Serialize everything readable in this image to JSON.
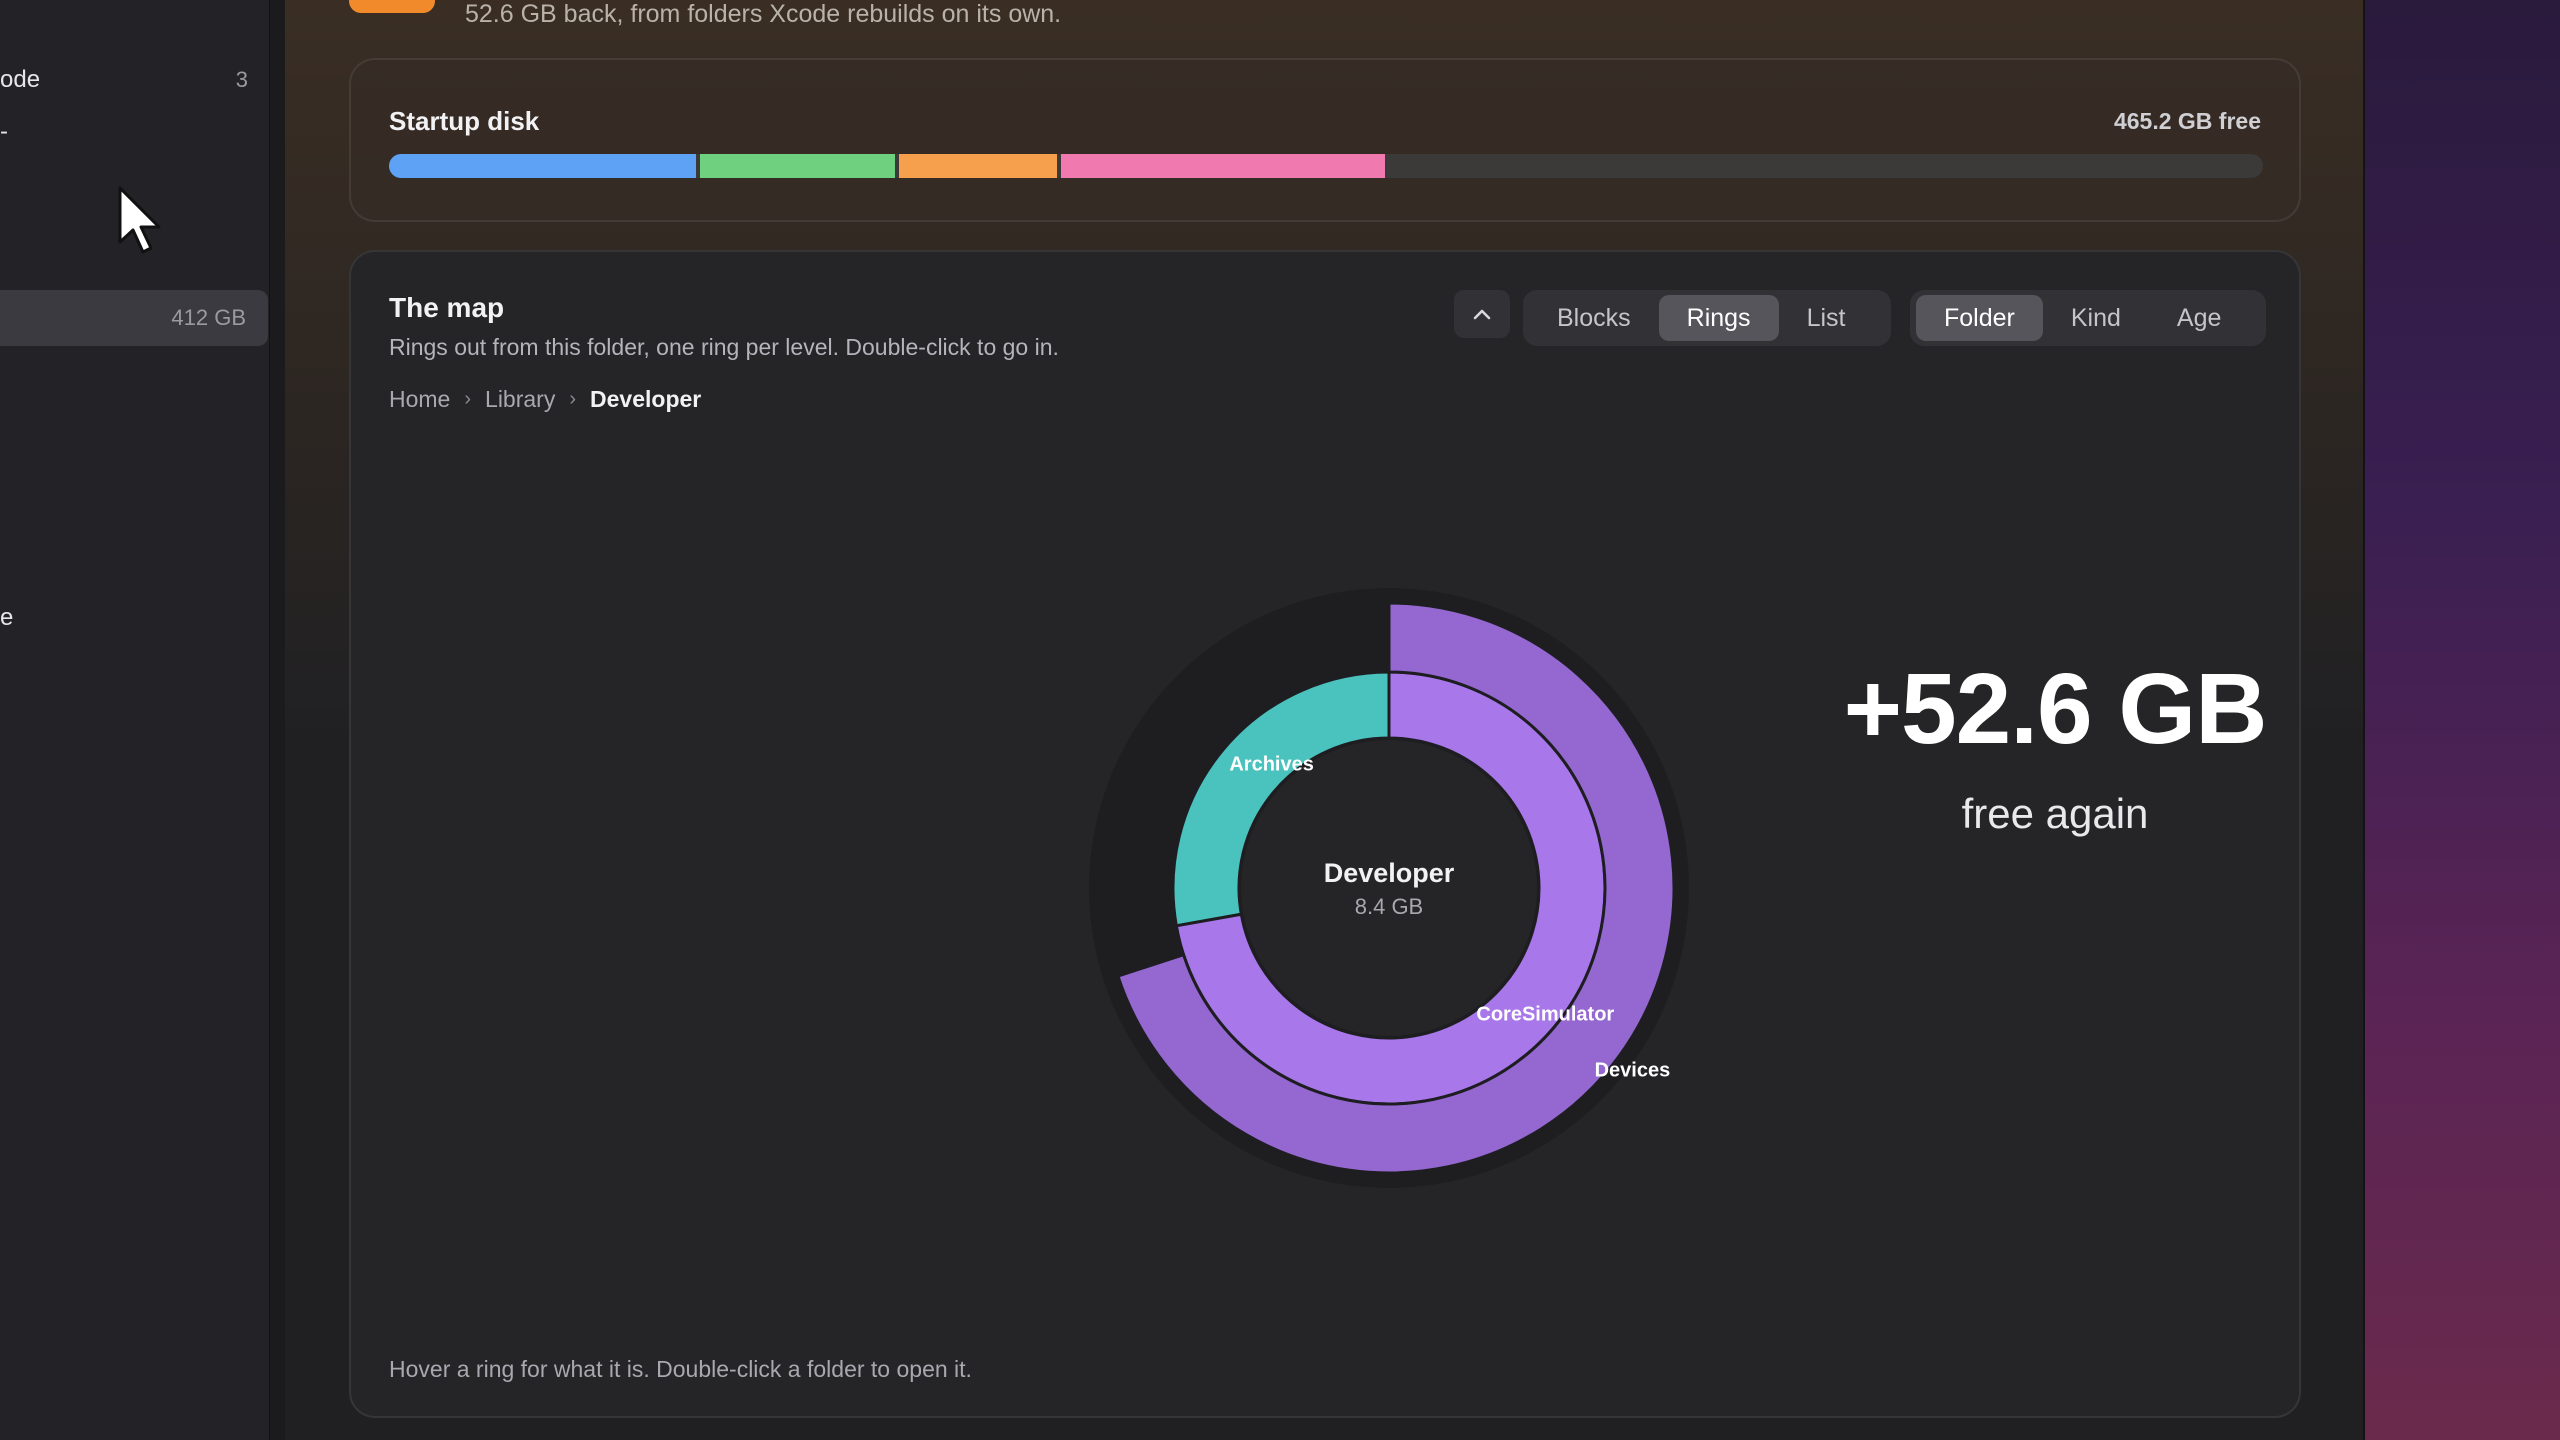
{
  "sidebar": {
    "items": [
      {
        "label": "ode",
        "count": "3"
      },
      {
        "label": "-",
        "count": ""
      },
      {
        "label": "",
        "count": "412 GB"
      },
      {
        "label": "e",
        "count": ""
      }
    ]
  },
  "header": {
    "subtitle": "52.6 GB back, from folders Xcode rebuilds on its own."
  },
  "startup_disk": {
    "title": "Startup disk",
    "free_label": "465.2 GB free",
    "segments": [
      {
        "fraction": 0.164,
        "color": "#5ea2f5"
      },
      {
        "fraction": 0.104,
        "color": "#6fd07f"
      },
      {
        "fraction": 0.084,
        "color": "#f6a04d"
      },
      {
        "fraction": 0.173,
        "color": "#f07ab0"
      }
    ]
  },
  "map": {
    "title": "The map",
    "subtitle": "Rings out from this folder, one ring per level. Double-click to go in.",
    "collapse_glyph": "^",
    "view_modes": [
      "Blocks",
      "Rings",
      "List"
    ],
    "active_view": "Rings",
    "color_modes": [
      "Folder",
      "Kind",
      "Age"
    ],
    "active_color": "Folder",
    "breadcrumb": [
      "Home",
      "Library",
      "Developer"
    ],
    "center_name": "Developer",
    "center_size": "8.4 GB",
    "rings": [
      {
        "label": "Archives",
        "level": 1,
        "start_fraction": 0.722,
        "end_fraction": 1.0,
        "color": "#4ac2bd"
      },
      {
        "label": "CoreSimulator",
        "level": 1,
        "start_fraction": 0.0,
        "end_fraction": 0.722,
        "color": "#a877ea"
      },
      {
        "label": "Devices",
        "level": 2,
        "start_fraction": 0.0,
        "end_fraction": 0.7,
        "color": "#9468d0"
      }
    ],
    "freed_amount": "+52.6 GB",
    "freed_caption": "free again",
    "footer": "Hover a ring for what it is. Double-click a folder to open it."
  },
  "colors": {
    "accent_orange": "#f08a2a",
    "card_bg": "#252528"
  }
}
